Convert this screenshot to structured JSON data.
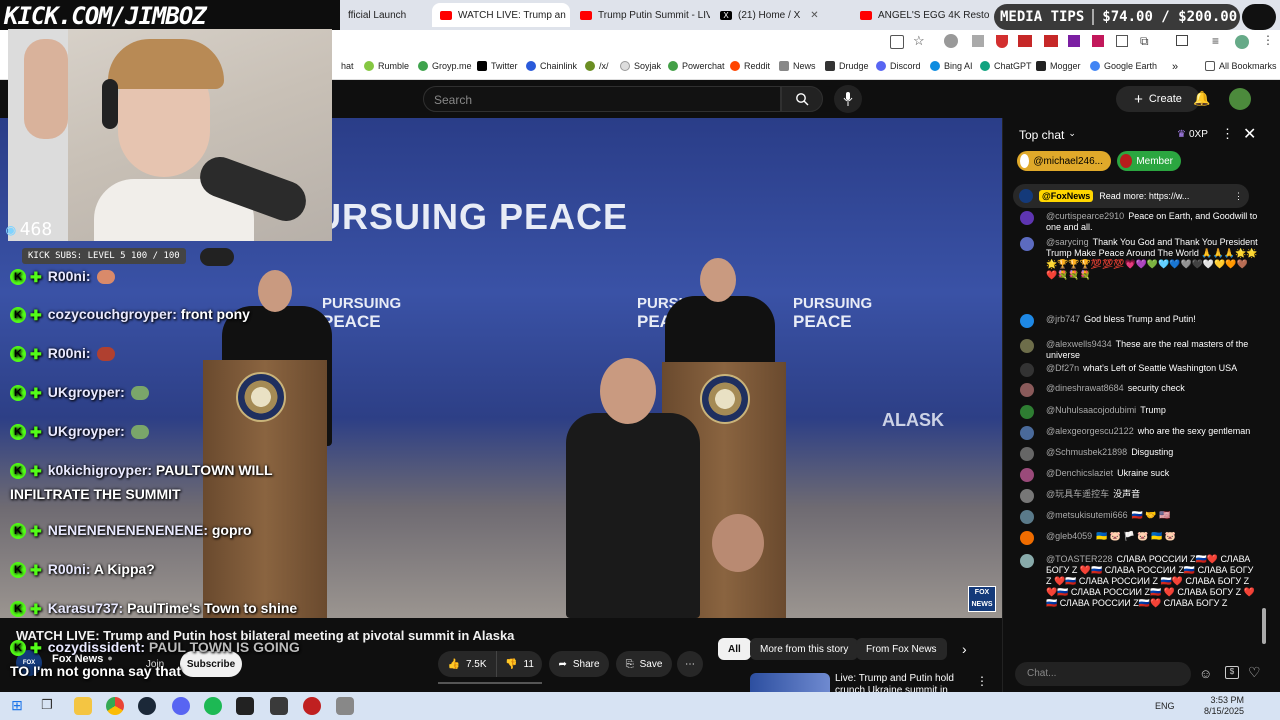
{
  "stream_overlay": {
    "kick_url": "KICK.COM/JIMBOZ",
    "viewer_count": "468",
    "kick_subs": "KICK SUBS: LEVEL 5 100 / 100",
    "media_tips": {
      "label": "MEDIA TIPS",
      "amount": "$74.00 / $200.00"
    },
    "kick_chat": [
      {
        "user": "R00ni:",
        "text": ""
      },
      {
        "user": "cozycouchgroyper:",
        "text": "front pony"
      },
      {
        "user": "R00ni:",
        "text": ""
      },
      {
        "user": "UKgroyper:",
        "text": ""
      },
      {
        "user": "UKgroyper:",
        "text": ""
      },
      {
        "user": "k0kichigroyper:",
        "text": "PAULTOWN WILL"
      },
      {
        "user": "",
        "text": "INFILTRATE THE SUMMIT"
      },
      {
        "user": "NENENENENENENENE:",
        "text": "gopro"
      },
      {
        "user": "R00ni:",
        "text": "A Kippa?"
      },
      {
        "user": "Karasu737:",
        "text": "PaulTime's Town to shine"
      },
      {
        "user": "cozydissident:",
        "text": "PAUL TOWN IS GOING"
      },
      {
        "user": "",
        "text": "TO I'm not gonna say that"
      }
    ]
  },
  "browser": {
    "tabs": [
      {
        "label": "fficial Launch",
        "active": false
      },
      {
        "label": "WATCH LIVE: Trump an",
        "active": true
      },
      {
        "label": "Trump Putin Summit - LIVE",
        "active": false
      },
      {
        "label": "(21) Home / X",
        "active": false
      },
      {
        "label": "ANGEL'S EGG 4K Restorat",
        "active": false
      }
    ],
    "bookmarks": [
      "hat",
      "Rumble",
      "Groyp.me",
      "Twitter",
      "Chainlink",
      "/x/",
      "Soyjak",
      "Powerchat",
      "Reddit",
      "News",
      "Drudge",
      "Discord",
      "Bing AI",
      "ChatGPT",
      "Mogger",
      "Google Earth",
      "»",
      "All Bookmarks"
    ]
  },
  "youtube": {
    "search_placeholder": "Search",
    "create_label": "Create",
    "video_banner_main": "PURSUING PEACE",
    "video_banner_small": "PURSUING",
    "video_banner_small2": "PEACE",
    "video_banner_alaska": "ALASK",
    "fox_bug": "FOX NEWS",
    "title": "WATCH LIVE: Trump and Putin host bilateral meeting at pivotal summit in Alaska",
    "channel": "Fox News",
    "join_label": "Join",
    "subscribe_label": "Subscribe",
    "likes": "7.5K",
    "dislikes": "11",
    "share_label": "Share",
    "save_label": "Save",
    "chips": [
      "All",
      "More from this story",
      "From Fox News"
    ],
    "rec_title_line1": "Live: Trump and Putin hold",
    "rec_title_line2": "crunch Ukraine summit in"
  },
  "live_chat": {
    "header": "Top chat",
    "points": "0XP",
    "pill_user": "@michael246...",
    "pill_member": "Member",
    "pinned_user": "@FoxNews",
    "pinned_text": "Read more: https://w...",
    "input_placeholder": "Chat...",
    "messages": [
      {
        "user": "@curtispearce2910",
        "text": "Peace on Earth, and Goodwill to one and all.",
        "color": "#5e35b1"
      },
      {
        "user": "@sarycing",
        "text": "Thank You God and Thank You President Trump Make Peace Around The World 🙏🙏🙏🌟🌟🌟🏆🏆🏆💯💯💯💗💜💚🩵💙🩶🖤🤍💛🧡🤎❤️💐💐💐",
        "color": "#5c6bc0"
      },
      {
        "user": "@jrb747",
        "text": "God bless Trump and Putin!",
        "color": "#1e88e5"
      },
      {
        "user": "@alexwells9434",
        "text": "These are the real masters of the universe",
        "color": "#6d6d4a"
      },
      {
        "user": "@Df27n",
        "text": "what's Left of Seattle Washington USA",
        "color": "#333"
      },
      {
        "user": "@dineshrawat8684",
        "text": "security check",
        "color": "#8a5a5a"
      },
      {
        "user": "@Nuhulsaacojodubimi",
        "text": "Trump",
        "color": "#2e7d32"
      },
      {
        "user": "@alexgeorgescu2122",
        "text": "who are the sexy gentleman",
        "color": "#4a6a9a"
      },
      {
        "user": "@Schmusbek21898",
        "text": "Disgusting",
        "color": "#666"
      },
      {
        "user": "@Denchicslaziet",
        "text": "Ukraine suck",
        "color": "#9a4a7a"
      },
      {
        "user": "@玩具车遥控车",
        "text": "没声音",
        "color": "#777"
      },
      {
        "user": "@metsukisutemi666",
        "text": "🇷🇺 🤝 🇺🇸",
        "color": "#5a7a8a"
      },
      {
        "user": "@gleb4059",
        "text": "🇺🇦 🐷 🏳️ 🐷 🇺🇦 🐷",
        "color": "#ef6c00"
      },
      {
        "user": "@TOASTER228",
        "text": "СЛАВА РОССИИ Z🇷🇺❤️ СЛАВА БОГУ Z ❤️🇷🇺 СЛАВА РОССИИ Z🇷🇺 СЛАВА БОГУ Z ❤️🇷🇺 СЛАВА РОССИИ Z 🇷🇺❤️ СЛАВА БОГУ Z ❤️🇷🇺 СЛАВА РОССИИ Z🇷🇺 ❤️ СЛАВА БОГУ Z ❤️🇷🇺 СЛАВА РОССИИ Z🇷🇺❤️ СЛАВА БОГУ Z",
        "color": "#8aa"
      }
    ]
  },
  "taskbar": {
    "lang": "ENG",
    "time": "3:53 PM",
    "date": "8/15/2025"
  },
  "colors": {
    "kick_green": "#53fc18",
    "yt_red": "#ff0000",
    "chat_bg": "#0f0f0f"
  }
}
